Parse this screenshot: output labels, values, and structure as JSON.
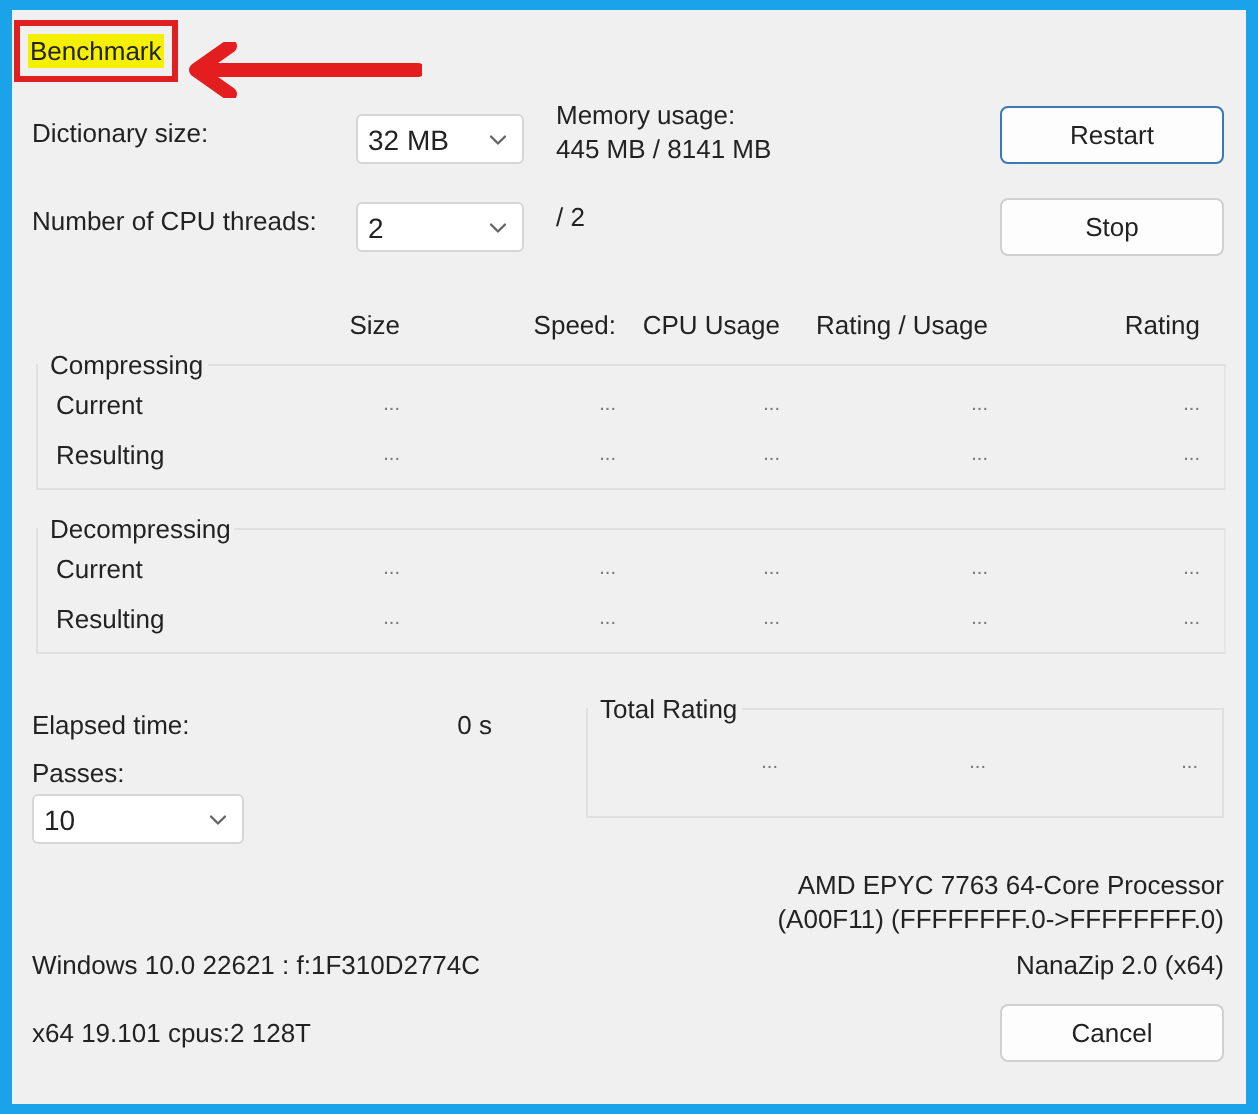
{
  "dialog": {
    "title": "Benchmark"
  },
  "settings": [
    {
      "label": "Dictionary size:",
      "value": "32 MB"
    },
    {
      "label": "Number of CPU threads:",
      "value": "2"
    }
  ],
  "memory": {
    "label": "Memory usage:",
    "value": "445 MB / 8141 MB"
  },
  "threads_total": "/ 2",
  "top_buttons": [
    {
      "label": "Restart",
      "default": true
    },
    {
      "label": "Stop",
      "default": false
    }
  ],
  "columns": [
    "Size",
    "Speed:",
    "CPU Usage",
    "Rating / Usage",
    "Rating"
  ],
  "groups": [
    {
      "title": "Compressing",
      "rows": [
        {
          "label": "Current",
          "cells": [
            "...",
            "...",
            "...",
            "...",
            "..."
          ]
        },
        {
          "label": "Resulting",
          "cells": [
            "...",
            "...",
            "...",
            "...",
            "..."
          ]
        }
      ]
    },
    {
      "title": "Decompressing",
      "rows": [
        {
          "label": "Current",
          "cells": [
            "...",
            "...",
            "...",
            "...",
            "..."
          ]
        },
        {
          "label": "Resulting",
          "cells": [
            "...",
            "...",
            "...",
            "...",
            "..."
          ]
        }
      ]
    }
  ],
  "elapsed": {
    "label": "Elapsed time:",
    "value": "0 s"
  },
  "passes": {
    "label": "Passes:",
    "value": "10"
  },
  "total_rating": {
    "title": "Total Rating",
    "cells": [
      "...",
      "...",
      "..."
    ]
  },
  "cpu_info": [
    "AMD EPYC 7763 64-Core Processor",
    "(A00F11) (FFFFFFFF.0->FFFFFFFF.0)"
  ],
  "os_info": "Windows 10.0 22621 :  f:1F310D2774C",
  "app_version": "NanaZip 2.0 (x64)",
  "build_info": "x64 19.101 cpus:2 128T",
  "cancel_button": "Cancel"
}
